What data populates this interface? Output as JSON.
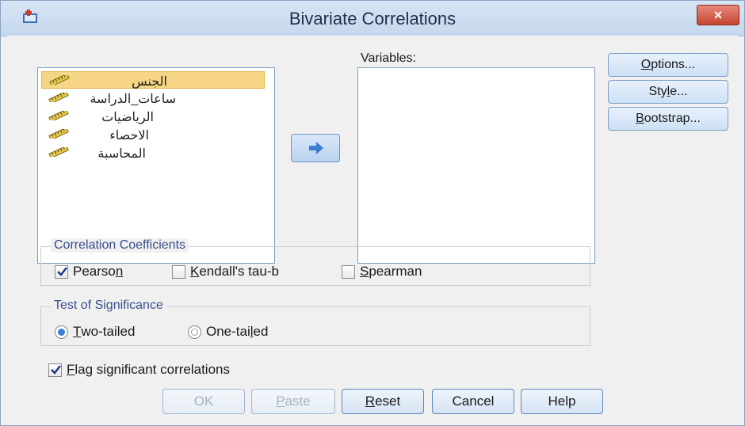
{
  "window": {
    "title": "Bivariate Correlations",
    "close_label": "×"
  },
  "source_list": {
    "items": [
      {
        "label": "الجنس",
        "selected": true,
        "icon": "scale-ruler-icon"
      },
      {
        "label": "ساعات_الدراسة",
        "selected": false,
        "icon": "scale-ruler-icon"
      },
      {
        "label": "الرياضيات",
        "selected": false,
        "icon": "scale-ruler-icon"
      },
      {
        "label": "الاحصاء",
        "selected": false,
        "icon": "scale-ruler-icon"
      },
      {
        "label": "المحاسبة",
        "selected": false,
        "icon": "scale-ruler-icon"
      }
    ]
  },
  "variables": {
    "label": "Variables:",
    "items": []
  },
  "move_button": {
    "icon": "right-arrow-icon"
  },
  "side_buttons": {
    "options": {
      "pre": "",
      "mn": "O",
      "post": "ptions..."
    },
    "style": {
      "pre": "Sty",
      "mn": "l",
      "post": "e..."
    },
    "bootstrap": {
      "pre": "",
      "mn": "B",
      "post": "ootstrap..."
    }
  },
  "coefficients": {
    "legend": "Correlation Coefficients",
    "pearson": {
      "pre": "Pearso",
      "mn": "n",
      "post": "",
      "checked": true
    },
    "kendall": {
      "pre": "",
      "mn": "K",
      "post": "endall's tau-b",
      "checked": false
    },
    "spearman": {
      "pre": "",
      "mn": "S",
      "post": "pearman",
      "checked": false
    }
  },
  "significance": {
    "legend": "Test of Significance",
    "two_tailed": {
      "pre": "",
      "mn": "T",
      "post": "wo-tailed",
      "selected": true
    },
    "one_tailed": {
      "pre": "One-tai",
      "mn": "l",
      "post": "ed",
      "selected": false
    }
  },
  "flag": {
    "pre": "",
    "mn": "F",
    "post": "lag significant correlations",
    "checked": true
  },
  "bottom_buttons": {
    "ok": {
      "label": "OK",
      "enabled": false
    },
    "paste": {
      "pre": "",
      "mn": "P",
      "post": "aste",
      "enabled": false
    },
    "reset": {
      "pre": "",
      "mn": "R",
      "post": "eset",
      "enabled": true
    },
    "cancel": {
      "label": "Cancel",
      "enabled": true
    },
    "help": {
      "label": "Help",
      "enabled": true
    }
  },
  "colors": {
    "selection": "#f6d684",
    "accent": "#3b7ed6",
    "close": "#c7442f"
  }
}
